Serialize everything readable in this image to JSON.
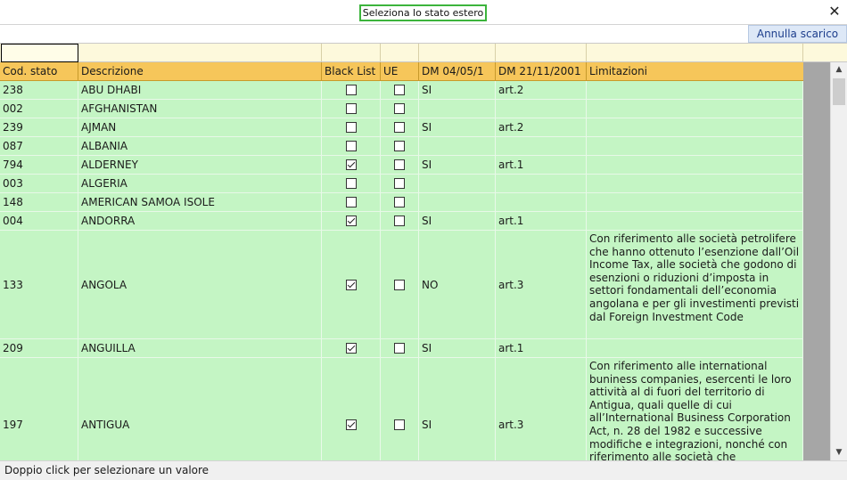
{
  "window": {
    "title": "Seleziona lo stato estero",
    "close_glyph": "✕"
  },
  "toolbar": {
    "cancel_label": "Annulla scarico"
  },
  "filter": {
    "value": ""
  },
  "table": {
    "columns": [
      "Cod. stato",
      "Descrizione",
      "Black List",
      "UE",
      "DM 04/05/1",
      "DM 21/11/2001",
      "Limitazioni"
    ],
    "rows": [
      {
        "code": "238",
        "desc": "ABU DHABI",
        "black": false,
        "ue": false,
        "dm1": "SI",
        "dm2": "art.2",
        "lim": ""
      },
      {
        "code": "002",
        "desc": "AFGHANISTAN",
        "black": false,
        "ue": false,
        "dm1": "",
        "dm2": "",
        "lim": ""
      },
      {
        "code": "239",
        "desc": "AJMAN",
        "black": false,
        "ue": false,
        "dm1": "SI",
        "dm2": "art.2",
        "lim": ""
      },
      {
        "code": "087",
        "desc": "ALBANIA",
        "black": false,
        "ue": false,
        "dm1": "",
        "dm2": "",
        "lim": ""
      },
      {
        "code": "794",
        "desc": "ALDERNEY",
        "black": true,
        "ue": false,
        "dm1": "SI",
        "dm2": "art.1",
        "lim": ""
      },
      {
        "code": "003",
        "desc": "ALGERIA",
        "black": false,
        "ue": false,
        "dm1": "",
        "dm2": "",
        "lim": ""
      },
      {
        "code": "148",
        "desc": "AMERICAN SAMOA ISOLE",
        "black": false,
        "ue": false,
        "dm1": "",
        "dm2": "",
        "lim": ""
      },
      {
        "code": "004",
        "desc": "ANDORRA",
        "black": true,
        "ue": false,
        "dm1": "SI",
        "dm2": "art.1",
        "lim": ""
      },
      {
        "code": "133",
        "desc": "ANGOLA",
        "black": true,
        "ue": false,
        "dm1": "NO",
        "dm2": "art.3",
        "lim": "Con riferimento alle società petrolifere che hanno ottenuto l’esenzione dall’Oil Income Tax, alle società che godono di esenzioni o riduzioni d’imposta in settori fondamentali dell’economia angolana e per gli investimenti previsti dal Foreign Investment Code"
      },
      {
        "code": "209",
        "desc": "ANGUILLA",
        "black": true,
        "ue": false,
        "dm1": "SI",
        "dm2": "art.1",
        "lim": ""
      },
      {
        "code": "197",
        "desc": "ANTIGUA",
        "black": true,
        "ue": false,
        "dm1": "SI",
        "dm2": "art.3",
        "lim": "Con riferimento alle international buniness companies, esercenti le loro attività al di fuori del territorio di Antigua, quali quelle di cui all’International Business Corporation Act, n. 28 del 1982 e successive modifiche e integrazioni, nonché con riferimento alle società che"
      }
    ]
  },
  "status": {
    "text": "Doppio click per selezionare un valore"
  },
  "colors": {
    "row_bg": "#c4f5c4",
    "header_bg": "#f6c65a",
    "filter_bg": "#fdf9dc",
    "title_border": "#3cb43c"
  }
}
